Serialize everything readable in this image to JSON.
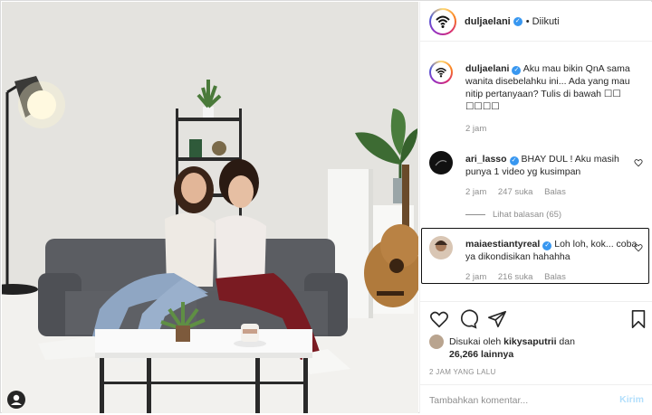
{
  "header": {
    "username": "duljaelani",
    "dot": "•",
    "follow_label": "Diikuti"
  },
  "caption": {
    "username": "duljaelani",
    "text": "Aku mau bikin QnA sama wanita disebelahku ini... Ada yang mau nitip pertanyaan? Tulis di bawah ☐☐ ☐☐☐☐",
    "time": "2 jam"
  },
  "comments": [
    {
      "username": "ari_lasso",
      "text": "BHAY DUL ! Aku masih punya 1 video yg kusimpan",
      "time": "2 jam",
      "likes": "247 suka",
      "reply": "Balas",
      "view_replies": "Lihat balasan (65)"
    },
    {
      "username": "maiaestiantyreal",
      "text": "Loh loh, kok... coba ya dikondisikan hahahha",
      "time": "2 jam",
      "likes": "216 suka",
      "reply": "Balas"
    }
  ],
  "likes": {
    "prefix": "Disukai oleh",
    "user": "kikysaputrii",
    "and": "dan",
    "count": "26,266 lainnya"
  },
  "post_time": "2 JAM YANG LALU",
  "add_comment": {
    "placeholder": "Tambahkan komentar...",
    "post_label": "Kirim"
  },
  "colors": {
    "accent": "#3897f0",
    "muted": "#8e8e8e",
    "post_disabled": "#b2dffc",
    "border": "#dbdbdb"
  }
}
